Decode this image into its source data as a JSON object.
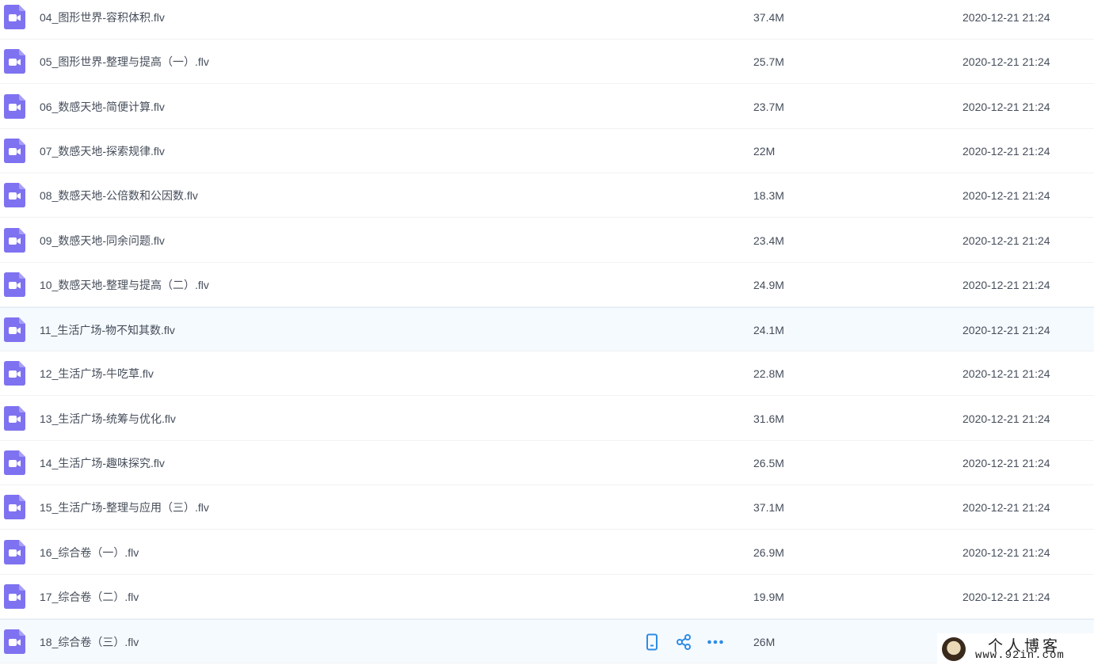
{
  "files": [
    {
      "name": "04_图形世界-容积体积.flv",
      "size": "37.4M",
      "date": "2020-12-21 21:24"
    },
    {
      "name": "05_图形世界-整理与提高（一）.flv",
      "size": "25.7M",
      "date": "2020-12-21 21:24"
    },
    {
      "name": "06_数感天地-简便计算.flv",
      "size": "23.7M",
      "date": "2020-12-21 21:24"
    },
    {
      "name": "07_数感天地-探索规律.flv",
      "size": "22M",
      "date": "2020-12-21 21:24"
    },
    {
      "name": "08_数感天地-公倍数和公因数.flv",
      "size": "18.3M",
      "date": "2020-12-21 21:24"
    },
    {
      "name": "09_数感天地-同余问题.flv",
      "size": "23.4M",
      "date": "2020-12-21 21:24"
    },
    {
      "name": "10_数感天地-整理与提高（二）.flv",
      "size": "24.9M",
      "date": "2020-12-21 21:24"
    },
    {
      "name": "11_生活广场-物不知其数.flv",
      "size": "24.1M",
      "date": "2020-12-21 21:24"
    },
    {
      "name": "12_生活广场-牛吃草.flv",
      "size": "22.8M",
      "date": "2020-12-21 21:24"
    },
    {
      "name": "13_生活广场-统筹与优化.flv",
      "size": "31.6M",
      "date": "2020-12-21 21:24"
    },
    {
      "name": "14_生活广场-趣味探究.flv",
      "size": "26.5M",
      "date": "2020-12-21 21:24"
    },
    {
      "name": "15_生活广场-整理与应用（三）.flv",
      "size": "37.1M",
      "date": "2020-12-21 21:24"
    },
    {
      "name": "16_综合卷（一）.flv",
      "size": "26.9M",
      "date": "2020-12-21 21:24"
    },
    {
      "name": "17_综合卷（二）.flv",
      "size": "19.9M",
      "date": "2020-12-21 21:24"
    },
    {
      "name": "18_综合卷（三）.flv",
      "size": "26M",
      "date": ""
    }
  ],
  "highlighted_rows": [
    7,
    14
  ],
  "hover_row_actions": [
    "phone-icon",
    "share-icon",
    "more-icon"
  ],
  "colors": {
    "file_icon": "#7f72f0",
    "action_icon": "#2e8ce6",
    "row_highlight": "#f5fafe"
  },
  "watermark": {
    "title": "个人博客",
    "url": "www.92in.com"
  }
}
